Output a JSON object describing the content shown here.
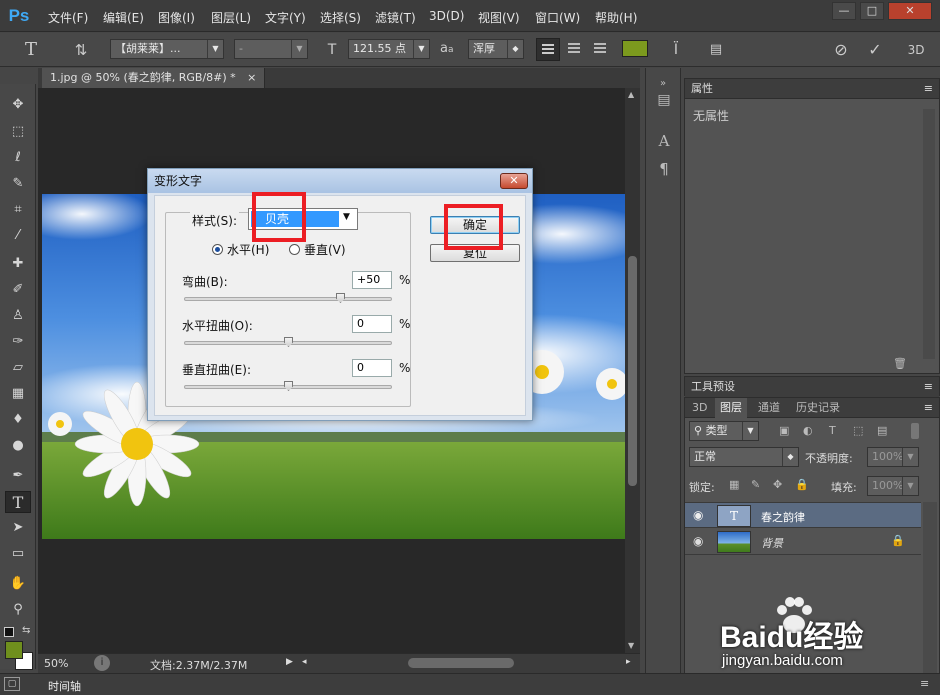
{
  "app": {
    "logo": "Ps"
  },
  "menu": [
    "文件(F)",
    "编辑(E)",
    "图像(I)",
    "图层(L)",
    "文字(Y)",
    "选择(S)",
    "滤镜(T)",
    "3D(D)",
    "视图(V)",
    "窗口(W)",
    "帮助(H)"
  ],
  "window_controls": {
    "minimize": "—",
    "maximize": "□",
    "close": "✕"
  },
  "options": {
    "font_family": "【胡莱莱】...",
    "font_style": "-",
    "font_size": "121.55 点",
    "aa_label": "a",
    "aa_sub": "a",
    "aa_method": "浑厚",
    "text_color": "#7c9a1e"
  },
  "document": {
    "tab_title": "1.jpg @ 50% (春之韵律, RGB/8#) *",
    "tab_close": "×",
    "zoom": "50%",
    "doc_info": "文档:2.37M/2.37M"
  },
  "timeline": {
    "label": "时间轴"
  },
  "properties": {
    "title": "属性",
    "content": "无属性"
  },
  "tool_presets": {
    "title": "工具预设"
  },
  "layers_panel": {
    "tabs": [
      "3D",
      "图层",
      "通道",
      "历史记录"
    ],
    "active_tab": "图层",
    "filter_type": "类型",
    "blend_mode": "正常",
    "opacity_label": "不透明度:",
    "opacity_value": "100%",
    "lock_label": "锁定:",
    "fill_label": "填充:",
    "fill_value": "100%",
    "layers": [
      {
        "name": "春之韵律",
        "type": "text",
        "thumb": "T"
      },
      {
        "name": "背景",
        "type": "image",
        "thumb": ""
      }
    ]
  },
  "dialog": {
    "title": "变形文字",
    "close": "✕",
    "style_label": "样式(S):",
    "style_value": "贝壳",
    "horizontal_label": "水平(H)",
    "vertical_label": "垂直(V)",
    "orientation": "horizontal",
    "bend": {
      "label": "弯曲(B):",
      "value": "+50",
      "unit": "%",
      "level": 75
    },
    "h_distortion": {
      "label": "水平扭曲(O):",
      "value": "0",
      "unit": "%",
      "level": 50
    },
    "v_distortion": {
      "label": "垂直扭曲(E):",
      "value": "0",
      "unit": "%",
      "level": 50
    },
    "ok_label": "确定",
    "reset_label": "复位"
  },
  "watermark": {
    "brand": "Baidu经验",
    "url": "jingyan.baidu.com"
  },
  "colors": {
    "foreground": "#6f8f1d",
    "background": "#ffffff",
    "highlight": "#ec1e24",
    "selection": "#3399ff"
  }
}
